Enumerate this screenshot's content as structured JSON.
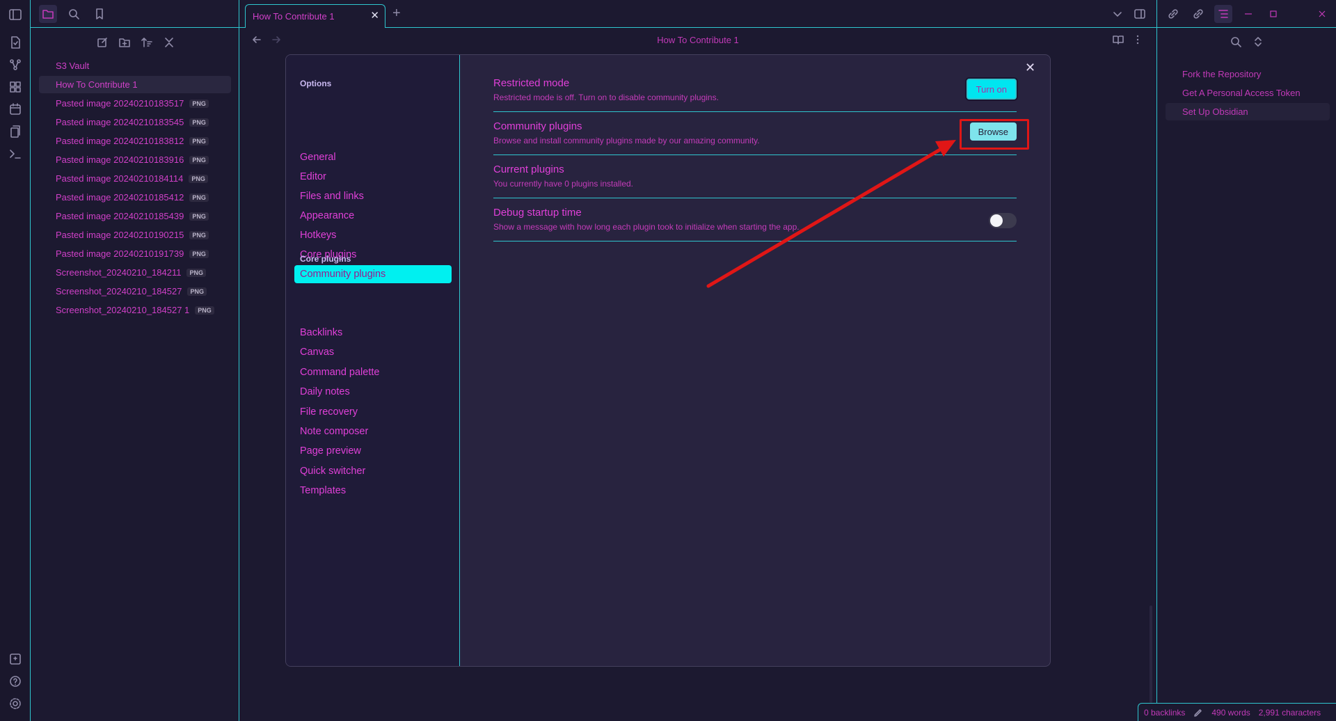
{
  "explorer": {
    "vault_name": "S3 Vault",
    "files": [
      {
        "name": "How To Contribute 1",
        "badge": "",
        "active": true
      },
      {
        "name": "Pasted image 20240210183517",
        "badge": "PNG"
      },
      {
        "name": "Pasted image 20240210183545",
        "badge": "PNG"
      },
      {
        "name": "Pasted image 20240210183812",
        "badge": "PNG"
      },
      {
        "name": "Pasted image 20240210183916",
        "badge": "PNG"
      },
      {
        "name": "Pasted image 20240210184114",
        "badge": "PNG"
      },
      {
        "name": "Pasted image 20240210185412",
        "badge": "PNG"
      },
      {
        "name": "Pasted image 20240210185439",
        "badge": "PNG"
      },
      {
        "name": "Pasted image 20240210190215",
        "badge": "PNG"
      },
      {
        "name": "Pasted image 20240210191739",
        "badge": "PNG"
      },
      {
        "name": "Screenshot_20240210_184211",
        "badge": "PNG"
      },
      {
        "name": "Screenshot_20240210_184527",
        "badge": "PNG"
      },
      {
        "name": "Screenshot_20240210_184527 1",
        "badge": "PNG"
      }
    ]
  },
  "tab": {
    "title": "How To Contribute 1",
    "close": "✕",
    "new_tab": "+"
  },
  "view": {
    "title": "How To Contribute 1"
  },
  "outline": {
    "items": [
      {
        "label": "Fork the Repository"
      },
      {
        "label": "Get A Personal Access Token"
      },
      {
        "label": "Set Up Obsidian",
        "active": true
      }
    ]
  },
  "status": {
    "backlinks": "0 backlinks",
    "words": "490 words",
    "characters": "2,991 characters"
  },
  "settings": {
    "options_title": "Options",
    "options": [
      "General",
      "Editor",
      "Files and links",
      "Appearance",
      "Hotkeys",
      "Core plugins",
      "Community plugins"
    ],
    "active_option": "Community plugins",
    "core_title": "Core plugins",
    "core_plugins": [
      "Backlinks",
      "Canvas",
      "Command palette",
      "Daily notes",
      "File recovery",
      "Note composer",
      "Page preview",
      "Quick switcher",
      "Templates"
    ],
    "close": "✕",
    "items": [
      {
        "name": "Restricted mode",
        "desc": "Restricted mode is off. Turn on to disable community plugins.",
        "button": "Turn on"
      },
      {
        "name": "Community plugins",
        "desc": "Browse and install community plugins made by our amazing community.",
        "button": "Browse"
      },
      {
        "name": "Current plugins",
        "desc": "You currently have 0 plugins installed."
      },
      {
        "name": "Debug startup time",
        "desc": "Show a message with how long each plugin took to initialize when starting the app.",
        "toggle": false
      }
    ]
  },
  "colors": {
    "accent": "#2fc6cf",
    "text": "#e040d8",
    "annotation": "#e01616",
    "button": "#00e5f0"
  },
  "icons": [
    "sidebar-toggle-icon",
    "folder-icon",
    "search-icon",
    "bookmark-icon",
    "new-note-icon",
    "new-folder-icon",
    "sort-icon",
    "collapse-icon",
    "back-icon",
    "forward-icon",
    "reading-view-icon",
    "more-options-icon",
    "chevron-down-icon",
    "right-sidebar-icon",
    "link-icon",
    "outgoing-link-icon",
    "outline-icon",
    "minimize-icon",
    "maximize-icon",
    "window-close-icon",
    "file-icon",
    "graph-icon",
    "canvas-icon",
    "calendar-icon",
    "templates-icon",
    "terminal-icon",
    "vault-icon",
    "help-icon",
    "settings-icon",
    "pencil-icon",
    "red-arrow-annotation"
  ]
}
